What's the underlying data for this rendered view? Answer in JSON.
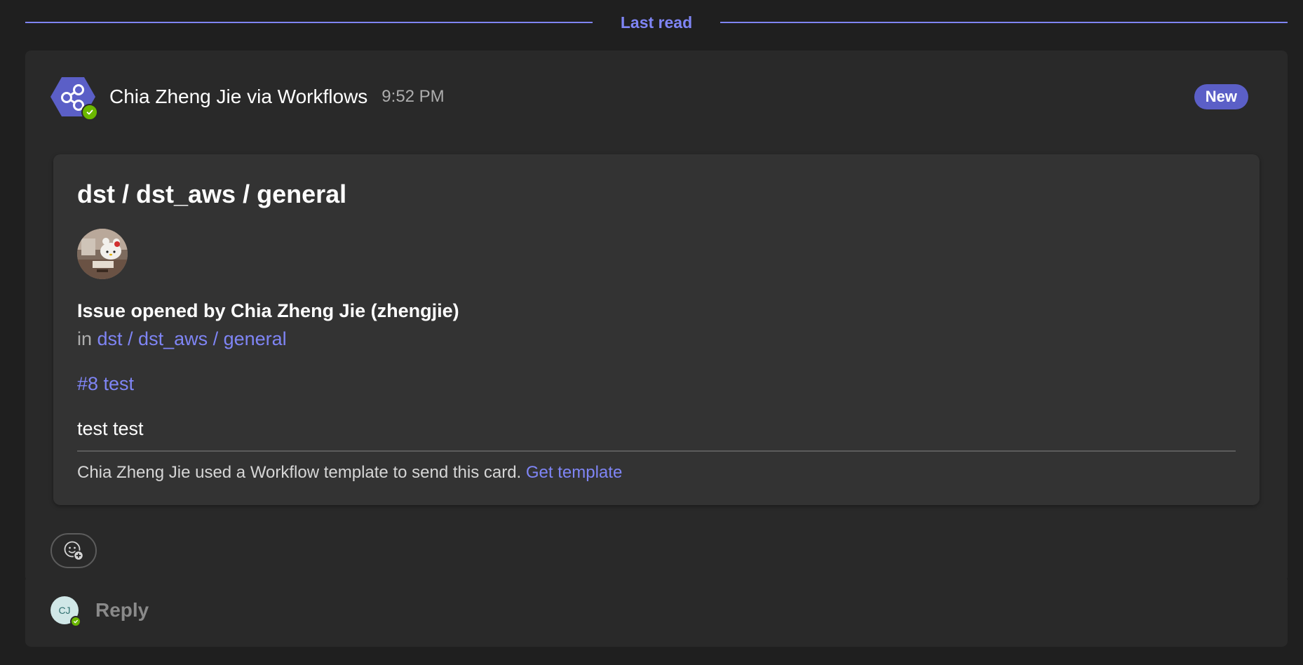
{
  "divider": {
    "label": "Last read"
  },
  "message": {
    "sender": "Chia Zheng Jie via Workflows",
    "time": "9:52 PM",
    "badge": "New",
    "app_icon": "share-nodes-icon",
    "presence": "available-check-icon"
  },
  "card": {
    "title": "dst / dst_aws / general",
    "issue_line": "Issue opened by Chia Zheng Jie (zhengjie)",
    "in_prefix": "in",
    "repo_link": "dst / dst_aws / general",
    "issue_link": "#8 test",
    "body": "test test",
    "footer_text": "Chia Zheng Jie used a Workflow template to send this card.",
    "footer_link": "Get template"
  },
  "reaction": {
    "icon": "emoji-add-icon"
  },
  "reply": {
    "avatar_initials": "CJ",
    "placeholder": "Reply"
  },
  "colors": {
    "accent": "#7f85f5",
    "badge": "#5b5fc7",
    "presence": "#6bb700",
    "background": "#1f1f1f",
    "surface": "#292929",
    "card": "#333333"
  }
}
